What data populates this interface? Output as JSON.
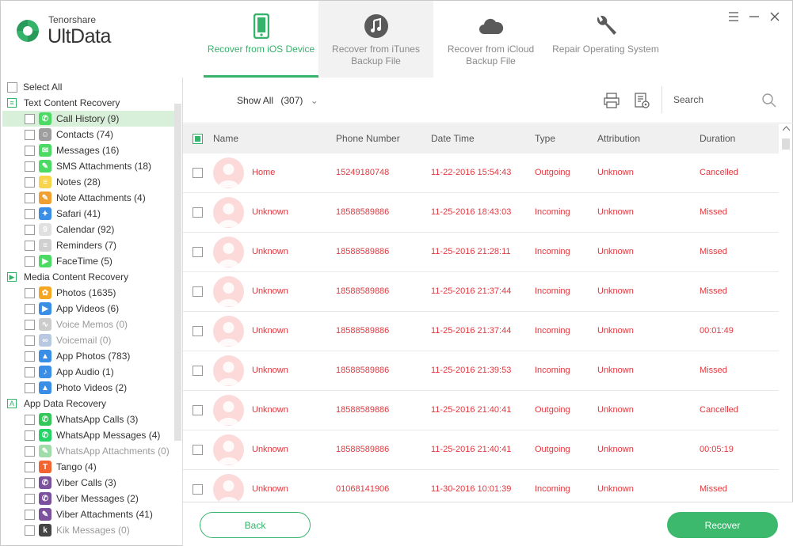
{
  "brand": {
    "company": "Tenorshare",
    "product": "UltData"
  },
  "tabs": [
    {
      "label": "Recover from iOS Device",
      "icon": "phone-icon",
      "active": true
    },
    {
      "label": "Recover from iTunes Backup File",
      "icon": "music-note-icon",
      "active": false
    },
    {
      "label": "Recover from iCloud Backup File",
      "icon": "cloud-icon",
      "active": false
    },
    {
      "label": "Repair Operating System",
      "icon": "wrench-icon",
      "active": false
    }
  ],
  "sidebar": {
    "select_all": "Select All",
    "categories": [
      {
        "label": "Text Content Recovery",
        "icon_glyph": "≡",
        "items": [
          {
            "label": "Call History (9)",
            "color": "#4cd964",
            "glyph": "✆",
            "selected": true,
            "dim": false
          },
          {
            "label": "Contacts (74)",
            "color": "#9e9e9e",
            "glyph": "☺",
            "selected": false,
            "dim": false
          },
          {
            "label": "Messages (16)",
            "color": "#4cd964",
            "glyph": "✉",
            "selected": false,
            "dim": false
          },
          {
            "label": "SMS Attachments (18)",
            "color": "#4cd964",
            "glyph": "✎",
            "selected": false,
            "dim": false
          },
          {
            "label": "Notes (28)",
            "color": "#f7d44c",
            "glyph": "≡",
            "selected": false,
            "dim": false
          },
          {
            "label": "Note Attachments (4)",
            "color": "#f0a030",
            "glyph": "✎",
            "selected": false,
            "dim": false
          },
          {
            "label": "Safari (41)",
            "color": "#3a8ee6",
            "glyph": "✦",
            "selected": false,
            "dim": false
          },
          {
            "label": "Calendar (92)",
            "color": "#e0e0e0",
            "glyph": "9",
            "selected": false,
            "dim": false
          },
          {
            "label": "Reminders (7)",
            "color": "#d0d0d0",
            "glyph": "≡",
            "selected": false,
            "dim": false
          },
          {
            "label": "FaceTime (5)",
            "color": "#4cd964",
            "glyph": "▶",
            "selected": false,
            "dim": false
          }
        ]
      },
      {
        "label": "Media Content Recovery",
        "icon_glyph": "▶",
        "items": [
          {
            "label": "Photos (1635)",
            "color": "#f5a623",
            "glyph": "✿",
            "selected": false,
            "dim": false
          },
          {
            "label": "App Videos (6)",
            "color": "#3a8ee6",
            "glyph": "▶",
            "selected": false,
            "dim": false
          },
          {
            "label": "Voice Memos (0)",
            "color": "#cccccc",
            "glyph": "∿",
            "selected": false,
            "dim": true
          },
          {
            "label": "Voicemail (0)",
            "color": "#b8c8e0",
            "glyph": "∞",
            "selected": false,
            "dim": true
          },
          {
            "label": "App Photos (783)",
            "color": "#3a8ee6",
            "glyph": "▲",
            "selected": false,
            "dim": false
          },
          {
            "label": "App Audio (1)",
            "color": "#3a8ee6",
            "glyph": "♪",
            "selected": false,
            "dim": false
          },
          {
            "label": "Photo Videos (2)",
            "color": "#3a8ee6",
            "glyph": "▲",
            "selected": false,
            "dim": false
          }
        ]
      },
      {
        "label": "App Data Recovery",
        "icon_glyph": "A",
        "items": [
          {
            "label": "WhatsApp Calls (3)",
            "color": "#34c759",
            "glyph": "✆",
            "selected": false,
            "dim": false
          },
          {
            "label": "WhatsApp Messages (4)",
            "color": "#25d366",
            "glyph": "✆",
            "selected": false,
            "dim": false
          },
          {
            "label": "WhatsApp Attachments (0)",
            "color": "#9fdcaa",
            "glyph": "✎",
            "selected": false,
            "dim": true
          },
          {
            "label": "Tango (4)",
            "color": "#f26430",
            "glyph": "T",
            "selected": false,
            "dim": false
          },
          {
            "label": "Viber Calls (3)",
            "color": "#7b519d",
            "glyph": "✆",
            "selected": false,
            "dim": false
          },
          {
            "label": "Viber Messages (2)",
            "color": "#7b519d",
            "glyph": "✆",
            "selected": false,
            "dim": false
          },
          {
            "label": "Viber Attachments (41)",
            "color": "#7b519d",
            "glyph": "✎",
            "selected": false,
            "dim": false
          },
          {
            "label": "Kik Messages (0)",
            "color": "#444444",
            "glyph": "k",
            "selected": false,
            "dim": true
          }
        ]
      }
    ]
  },
  "toolbar": {
    "show_all": "Show All",
    "count": "(307)",
    "search_placeholder": "Search"
  },
  "table": {
    "columns": [
      "Name",
      "Phone Number",
      "Date Time",
      "Type",
      "Attribution",
      "Duration"
    ],
    "rows": [
      [
        "Home",
        "15249180748",
        "11-22-2016 15:54:43",
        "Outgoing",
        "Unknown",
        "Cancelled"
      ],
      [
        "Unknown",
        "18588589886",
        "11-25-2016 18:43:03",
        "Incoming",
        "Unknown",
        "Missed"
      ],
      [
        "Unknown",
        "18588589886",
        "11-25-2016 21:28:11",
        "Incoming",
        "Unknown",
        "Missed"
      ],
      [
        "Unknown",
        "18588589886",
        "11-25-2016 21:37:44",
        "Incoming",
        "Unknown",
        "Missed"
      ],
      [
        "Unknown",
        "18588589886",
        "11-25-2016 21:37:44",
        "Incoming",
        "Unknown",
        "00:01:49"
      ],
      [
        "Unknown",
        "18588589886",
        "11-25-2016 21:39:53",
        "Incoming",
        "Unknown",
        "Missed"
      ],
      [
        "Unknown",
        "18588589886",
        "11-25-2016 21:40:41",
        "Outgoing",
        "Unknown",
        "Cancelled"
      ],
      [
        "Unknown",
        "18588589886",
        "11-25-2016 21:40:41",
        "Outgoing",
        "Unknown",
        "00:05:19"
      ],
      [
        "Unknown",
        "01068141906",
        "11-30-2016 10:01:39",
        "Incoming",
        "Unknown",
        "Missed"
      ]
    ]
  },
  "buttons": {
    "back": "Back",
    "recover": "Recover"
  },
  "colors": {
    "accent": "#35b36b",
    "record_text": "#e0383f",
    "avatar_bg": "#fcdada"
  }
}
